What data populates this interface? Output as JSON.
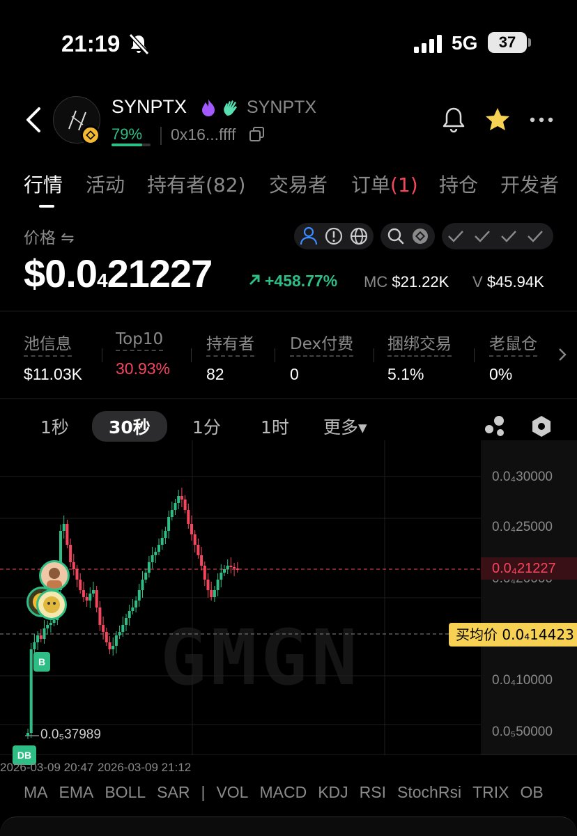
{
  "status_bar": {
    "time": "21:19",
    "network": "5G",
    "battery": "37"
  },
  "header": {
    "token_name": "SYNPTX",
    "token_symbol": "SYNPTX",
    "progress_text": "79%",
    "progress_value": 0.79,
    "address": "0x16...ffff"
  },
  "tabs": [
    {
      "label": "行情",
      "active": true
    },
    {
      "label": "活动"
    },
    {
      "label": "持有者(82)"
    },
    {
      "label": "交易者"
    },
    {
      "label": "订单",
      "badge": "(1)"
    },
    {
      "label": "持仓"
    },
    {
      "label": "开发者"
    }
  ],
  "price_section": {
    "label": "价格 ⇋",
    "price_prefix": "$0.0",
    "price_sub": "4",
    "price_suffix": "21227",
    "change": "+458.77%",
    "mc_label": "MC",
    "mc_value": "$21.22K",
    "v_label": "V",
    "v_value": "$45.94K"
  },
  "stats": [
    {
      "label": "池信息",
      "value": "$11.03K"
    },
    {
      "label": "Top10",
      "value": "30.93%",
      "color": "#f6465d"
    },
    {
      "label": "持有者",
      "value": "82"
    },
    {
      "label": "Dex付费",
      "value": "0"
    },
    {
      "label": "捆绑交易",
      "value": "5.1%"
    },
    {
      "label": "老鼠仓",
      "value": "0%"
    }
  ],
  "intervals": [
    "1秒",
    "30秒",
    "1分",
    "1时",
    "更多▾"
  ],
  "active_interval": "30秒",
  "chart": {
    "y_labels": [
      "0.0₄30000",
      "0.0₄25000",
      "0.0₄20000",
      "0.0₄10000",
      "0.0₅50000"
    ],
    "current_price_tag": "0.0₄21227",
    "avg_buy_tag": "买均价 0.0₄14423",
    "low_label": "0.0₅37989",
    "marker_b": "B",
    "marker_db": "DB",
    "x_labels": [
      "2026-03-09 20:47",
      "2026-03-09 21:12"
    ],
    "watermark": "GMGN"
  },
  "indicators": [
    "MA",
    "EMA",
    "BOLL",
    "SAR",
    "|",
    "VOL",
    "MACD",
    "KDJ",
    "RSI",
    "StochRsi",
    "TRIX",
    "OB"
  ],
  "colors": {
    "up": "#2ebd85",
    "down": "#f6465d",
    "accent": "#f7d154"
  }
}
